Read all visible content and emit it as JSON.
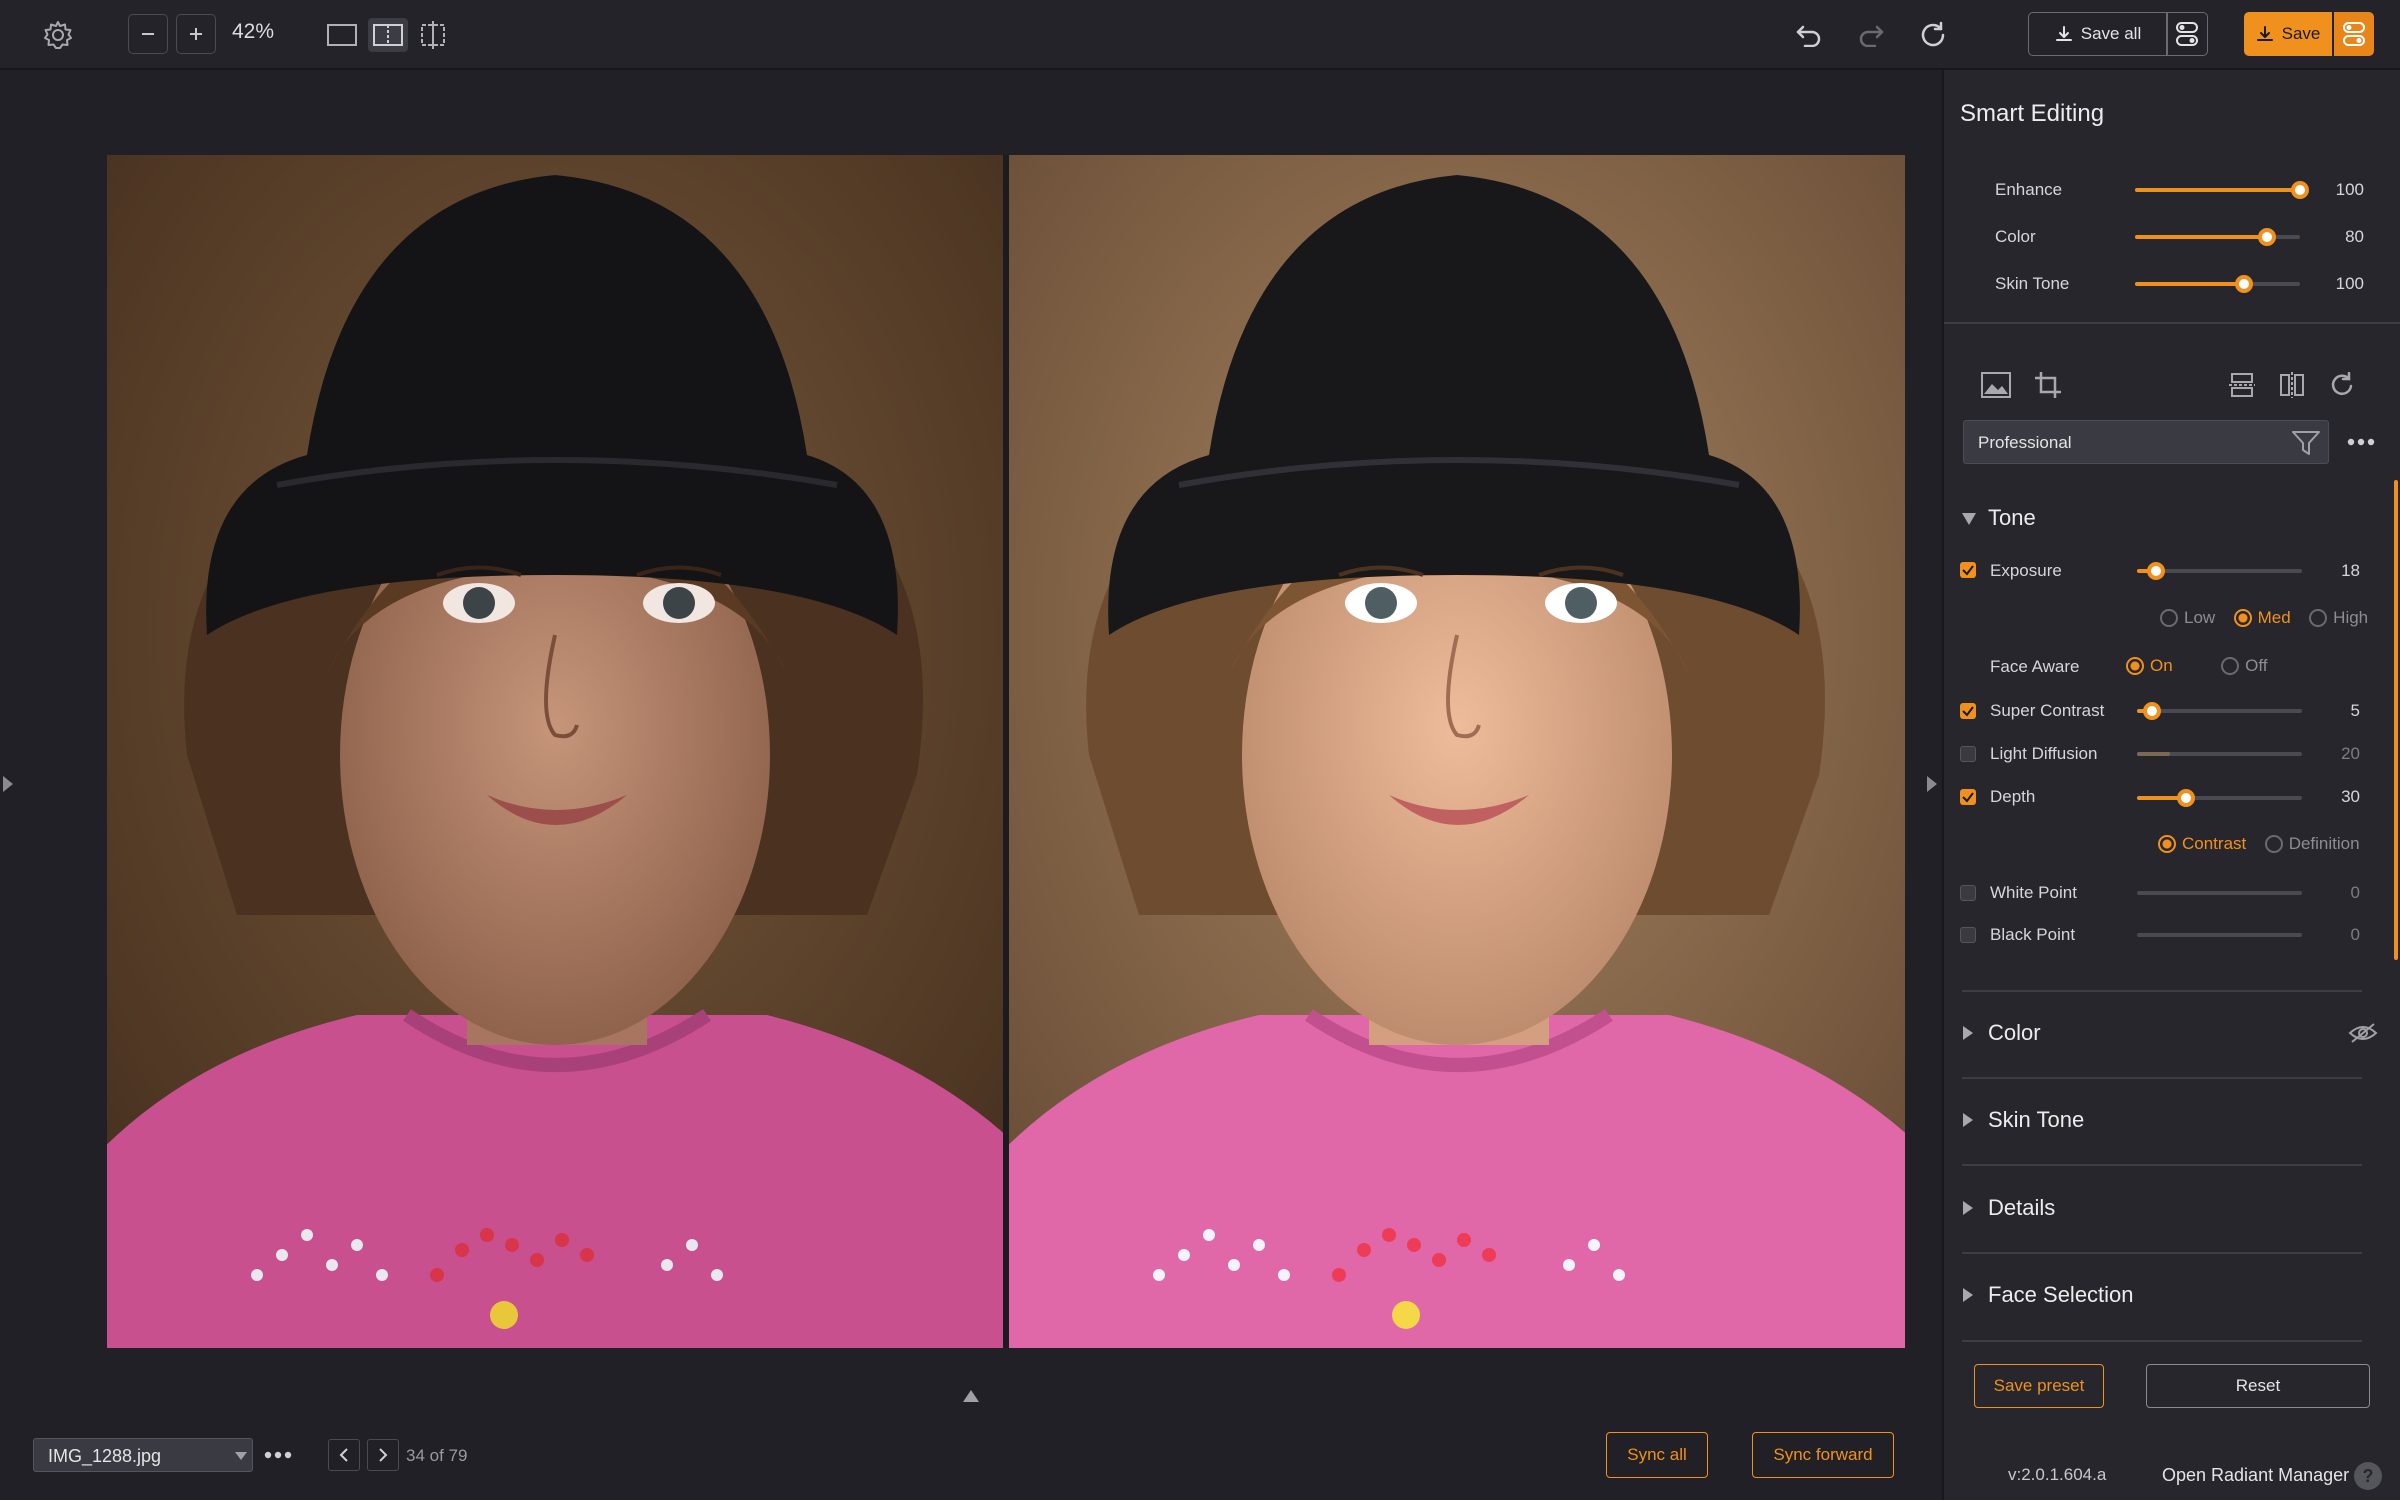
{
  "toolbar": {
    "zoom_level": "42%",
    "save_all_label": "Save all",
    "save_label": "Save"
  },
  "panel": {
    "title": "Smart Editing",
    "smart_sliders": [
      {
        "label": "Enhance",
        "value": 100,
        "fraction": 1.0
      },
      {
        "label": "Color",
        "value": 80,
        "fraction": 0.8
      },
      {
        "label": "Skin Tone",
        "value": 100,
        "fraction": 0.66
      }
    ],
    "preset_name": "Professional",
    "tone": {
      "title": "Tone",
      "exposure": {
        "label": "Exposure",
        "value": 18,
        "fraction": 0.11,
        "checked": true
      },
      "exposure_levels": [
        "Low",
        "Med",
        "High"
      ],
      "exposure_level_selected": "Med",
      "face_aware": {
        "label": "Face Aware",
        "options": [
          "On",
          "Off"
        ],
        "selected": "On"
      },
      "super_contrast": {
        "label": "Super Contrast",
        "value": 5,
        "fraction": 0.09,
        "checked": true
      },
      "light_diffusion": {
        "label": "Light Diffusion",
        "value": 20,
        "fraction": 0.2,
        "checked": false
      },
      "depth": {
        "label": "Depth",
        "value": 30,
        "fraction": 0.3,
        "checked": true
      },
      "depth_modes": [
        "Contrast",
        "Definition"
      ],
      "depth_mode_selected": "Contrast",
      "white_point": {
        "label": "White Point",
        "value": 0,
        "checked": false
      },
      "black_point": {
        "label": "Black Point",
        "value": 0,
        "checked": false
      }
    },
    "sections": [
      "Color",
      "Skin Tone",
      "Details",
      "Face Selection"
    ],
    "save_preset_label": "Save preset",
    "reset_label": "Reset",
    "version": "v:2.0.1.604.a",
    "manager_label": "Open Radiant Manager"
  },
  "bottom": {
    "file_name": "IMG_1288.jpg",
    "counter": "34 of 79",
    "sync_all_label": "Sync all",
    "sync_forward_label": "Sync forward"
  },
  "colors": {
    "accent": "#f0911d",
    "background": "#202026",
    "panel": "#26262c"
  }
}
